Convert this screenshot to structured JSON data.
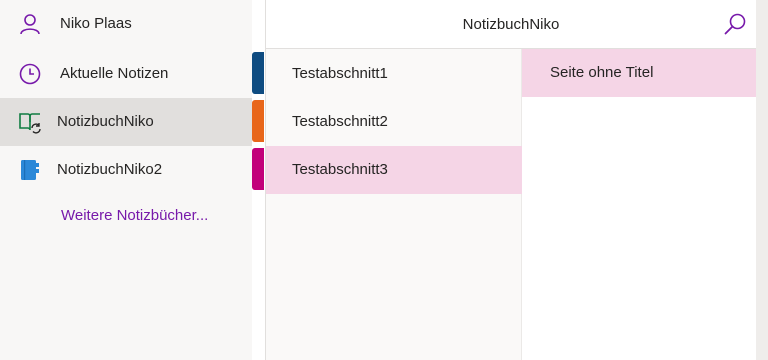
{
  "user": {
    "name": "Niko Plaas",
    "icon": "person-icon"
  },
  "nav": {
    "recent": {
      "label": "Aktuelle Notizen",
      "icon": "clock-icon"
    },
    "notebooks": [
      {
        "label": "NotizbuchNiko",
        "icon": "notebook-sync-icon",
        "selected": true
      },
      {
        "label": "NotizbuchNiko2",
        "icon": "notebook-icon",
        "selected": false
      }
    ],
    "more_label": "Weitere Notizbücher..."
  },
  "header": {
    "title": "NotizbuchNiko",
    "search_icon": "search-icon"
  },
  "sections": [
    {
      "label": "Testabschnitt1",
      "color": "#0f4c81",
      "selected": false
    },
    {
      "label": "Testabschnitt2",
      "color": "#e8661a",
      "selected": false
    },
    {
      "label": "Testabschnitt3",
      "color": "#c2007a",
      "selected": true
    }
  ],
  "pages": [
    {
      "label": "Seite ohne Titel",
      "selected": true
    }
  ],
  "colors": {
    "accent": "#7719aa",
    "selection_pink": "#f5d5e6",
    "notebook_green": "#107c41",
    "notebook_blue": "#2b88d8"
  }
}
